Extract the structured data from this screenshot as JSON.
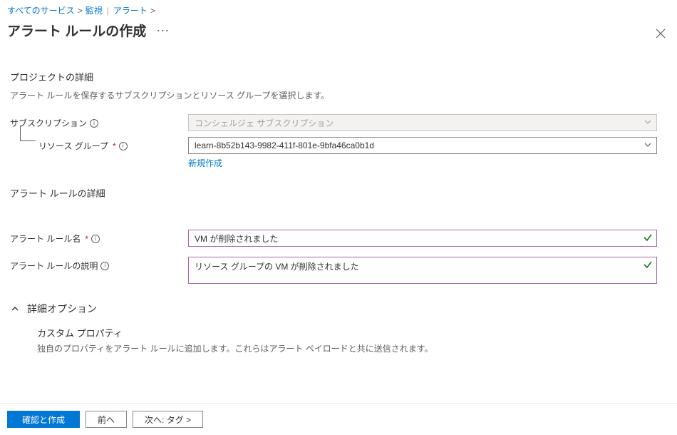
{
  "breadcrumb": {
    "services": "すべてのサービス",
    "monitor": "監視",
    "alerts": "アラート"
  },
  "page": {
    "title": "アラート ルールの作成"
  },
  "project": {
    "heading": "プロジェクトの詳細",
    "description": "アラート ルールを保存するサブスクリプションとリソース グループを選択します。",
    "subscription_label": "サブスクリプション",
    "subscription_value": "コンシェルジェ サブスクリプション",
    "resource_group_label": "リソース グループ",
    "resource_group_value": "learn-8b52b143-9982-411f-801e-9bfa46ca0b1d",
    "create_new": "新規作成"
  },
  "rule": {
    "heading": "アラート ルールの詳細",
    "name_label": "アラート ルール名",
    "name_value": "VM が削除されました",
    "desc_label": "アラート ルールの説明",
    "desc_value": "リソース グループの VM が削除されました"
  },
  "advanced": {
    "heading": "詳細オプション",
    "custom_title": "カスタム プロパティ",
    "custom_desc": "独自のプロパティをアラート ルールに追加します。これらはアラート ペイロードと共に送信されます。"
  },
  "footer": {
    "review_create": "確認と作成",
    "prev": "前へ",
    "next": "次へ: タグ >"
  }
}
